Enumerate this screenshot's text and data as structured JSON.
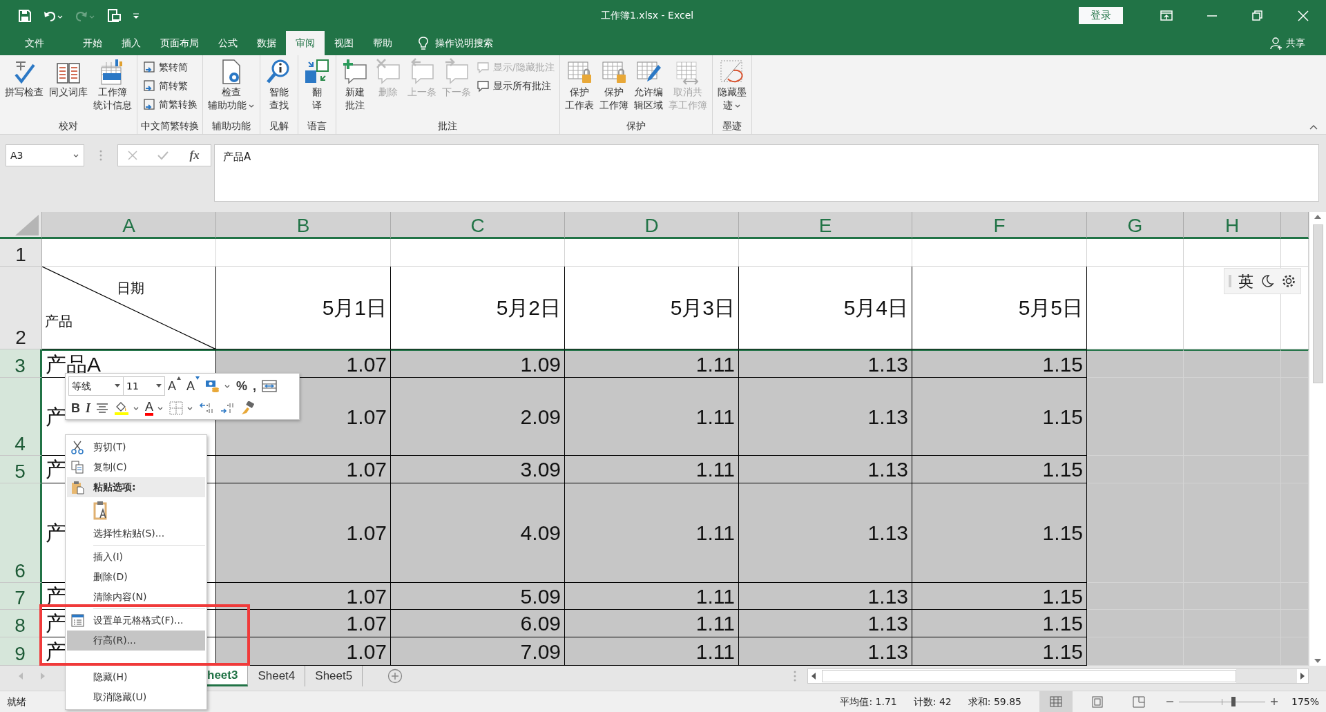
{
  "window": {
    "title": "工作簿1.xlsx  -  Excel",
    "login": "登录"
  },
  "tabs": [
    {
      "label": "文件",
      "selected": false
    },
    {
      "label": "开始",
      "selected": false
    },
    {
      "label": "插入",
      "selected": false
    },
    {
      "label": "页面布局",
      "selected": false
    },
    {
      "label": "公式",
      "selected": false
    },
    {
      "label": "数据",
      "selected": false
    },
    {
      "label": "审阅",
      "selected": true
    },
    {
      "label": "视图",
      "selected": false
    },
    {
      "label": "帮助",
      "selected": false
    }
  ],
  "tell_me": "操作说明搜索",
  "share": "共享",
  "ribbon": [
    {
      "label": "校对",
      "controls": [
        {
          "kind": "large",
          "lines": [
            "拼写检查"
          ],
          "disabled": false,
          "dropdown": false
        },
        {
          "kind": "large",
          "lines": [
            "同义词库"
          ],
          "disabled": false,
          "dropdown": false
        },
        {
          "kind": "large",
          "lines": [
            "工作簿",
            "统计信息"
          ],
          "disabled": false,
          "dropdown": false
        }
      ]
    },
    {
      "label": "中文简繁转换",
      "controls": [
        {
          "kind": "stack",
          "items": [
            {
              "label": "繁转简",
              "disabled": false
            },
            {
              "label": "简转繁",
              "disabled": false
            },
            {
              "label": "简繁转换",
              "disabled": false
            }
          ]
        }
      ]
    },
    {
      "label": "辅助功能",
      "controls": [
        {
          "kind": "large",
          "lines": [
            "检查",
            "辅助功能"
          ],
          "disabled": false,
          "dropdown": true
        }
      ]
    },
    {
      "label": "见解",
      "controls": [
        {
          "kind": "large",
          "lines": [
            "智能",
            "查找"
          ],
          "disabled": false,
          "dropdown": false
        }
      ]
    },
    {
      "label": "语言",
      "controls": [
        {
          "kind": "large",
          "lines": [
            "翻",
            "译"
          ],
          "disabled": false,
          "dropdown": false
        }
      ]
    },
    {
      "label": "批注",
      "controls": [
        {
          "kind": "large",
          "lines": [
            "新建",
            "批注"
          ],
          "disabled": false,
          "dropdown": false
        },
        {
          "kind": "large",
          "lines": [
            "删除"
          ],
          "disabled": true,
          "dropdown": false
        },
        {
          "kind": "large",
          "lines": [
            "上一条"
          ],
          "disabled": true,
          "dropdown": false
        },
        {
          "kind": "large",
          "lines": [
            "下一条"
          ],
          "disabled": true,
          "dropdown": false
        },
        {
          "kind": "stack",
          "items": [
            {
              "label": "显示/隐藏批注",
              "disabled": true
            },
            {
              "label": "显示所有批注",
              "disabled": false
            }
          ]
        }
      ]
    },
    {
      "label": "保护",
      "controls": [
        {
          "kind": "large",
          "lines": [
            "保护",
            "工作表"
          ],
          "disabled": false,
          "dropdown": false
        },
        {
          "kind": "large",
          "lines": [
            "保护",
            "工作簿"
          ],
          "disabled": false,
          "dropdown": false
        },
        {
          "kind": "large",
          "lines": [
            "允许编",
            "辑区域"
          ],
          "disabled": false,
          "dropdown": false
        },
        {
          "kind": "large",
          "lines": [
            "取消共",
            "享工作簿"
          ],
          "disabled": true,
          "dropdown": false
        }
      ]
    },
    {
      "label": "墨迹",
      "controls": [
        {
          "kind": "large",
          "lines": [
            "隐藏墨",
            "迹"
          ],
          "disabled": false,
          "dropdown": true
        }
      ]
    }
  ],
  "formula_bar": {
    "name_box": "A3",
    "function_label": "fx",
    "formula": "产品A"
  },
  "sheet": {
    "columns": [
      "A",
      "B",
      "C",
      "D",
      "E",
      "F",
      "G",
      "H"
    ],
    "rows": [
      {
        "number": "1",
        "selected": false,
        "cells": [
          "",
          "",
          "",
          "",
          "",
          "",
          "",
          ""
        ]
      },
      {
        "number": "2",
        "selected": false,
        "diagonal": {
          "top": "日期",
          "bottom": "产品"
        },
        "cells": [
          "",
          "5月1日",
          "5月2日",
          "5月3日",
          "5月4日",
          "5月5日",
          "",
          ""
        ]
      },
      {
        "number": "3",
        "selected": true,
        "cells": [
          "产品A",
          "1.07",
          "1.09",
          "1.11",
          "1.13",
          "1.15",
          "",
          ""
        ]
      },
      {
        "number": "4",
        "selected": true,
        "cells": [
          "产",
          "1.07",
          "2.09",
          "1.11",
          "1.13",
          "1.15",
          "",
          ""
        ]
      },
      {
        "number": "5",
        "selected": true,
        "cells": [
          "产",
          "1.07",
          "3.09",
          "1.11",
          "1.13",
          "1.15",
          "",
          ""
        ]
      },
      {
        "number": "6",
        "selected": true,
        "cells": [
          "产",
          "1.07",
          "4.09",
          "1.11",
          "1.13",
          "1.15",
          "",
          ""
        ]
      },
      {
        "number": "7",
        "selected": true,
        "cells": [
          "产",
          "1.07",
          "5.09",
          "1.11",
          "1.13",
          "1.15",
          "",
          ""
        ]
      },
      {
        "number": "8",
        "selected": true,
        "cells": [
          "产",
          "1.07",
          "6.09",
          "1.11",
          "1.13",
          "1.15",
          "",
          ""
        ]
      },
      {
        "number": "9",
        "selected": true,
        "cells": [
          "产",
          "1.07",
          "7.09",
          "1.11",
          "1.13",
          "1.15",
          "",
          ""
        ]
      }
    ]
  },
  "ime_bar": {
    "label": "英"
  },
  "mini_toolbar": {
    "font": "等线",
    "size": "11",
    "buttons": [
      [
        {
          "kind": "grow",
          "label": "A"
        },
        {
          "kind": "shrink",
          "label": "A"
        },
        {
          "kind": "accounting"
        },
        {
          "kind": "text",
          "label": "%"
        },
        {
          "kind": "text",
          "label": ","
        },
        {
          "kind": "wrap"
        }
      ],
      [
        {
          "kind": "bold",
          "label": "B"
        },
        {
          "kind": "italic",
          "label": "I"
        },
        {
          "kind": "align"
        },
        {
          "kind": "fill"
        },
        {
          "kind": "fontcolor",
          "label": "A"
        },
        {
          "kind": "borders"
        },
        {
          "kind": "incdec"
        },
        {
          "kind": "decdec"
        },
        {
          "kind": "painter"
        }
      ]
    ]
  },
  "context_menu": [
    {
      "kind": "item",
      "label": "剪切(T)",
      "selected": false
    },
    {
      "kind": "item",
      "label": "复制(C)",
      "selected": false
    },
    {
      "kind": "header",
      "label": "粘贴选项:",
      "selected": false
    },
    {
      "kind": "paste-option",
      "selected": false
    },
    {
      "kind": "item",
      "label": "选择性粘贴(S)...",
      "selected": false
    },
    {
      "kind": "separator"
    },
    {
      "kind": "item",
      "label": "插入(I)",
      "selected": false
    },
    {
      "kind": "item",
      "label": "删除(D)",
      "selected": false
    },
    {
      "kind": "item",
      "label": "清除内容(N)",
      "selected": false
    },
    {
      "kind": "separator"
    },
    {
      "kind": "item",
      "label": "设置单元格格式(F)...",
      "selected": false
    },
    {
      "kind": "item",
      "label": "行高(R)...",
      "selected": true
    },
    {
      "kind": "item",
      "label": "隐藏(H)",
      "selected": false
    },
    {
      "kind": "item",
      "label": "取消隐藏(U)",
      "selected": false
    }
  ],
  "sheet_tabs": [
    {
      "label": "heet3",
      "selected": true
    },
    {
      "label": "Sheet4",
      "selected": false
    },
    {
      "label": "Sheet5",
      "selected": false
    }
  ],
  "status_bar": {
    "ready": "就绪",
    "average": "平均值: 1.71",
    "count": "计数: 42",
    "sum": "求和: 59.85",
    "views": [
      {
        "selected": true
      },
      {
        "selected": false
      },
      {
        "selected": false
      }
    ],
    "zoom_slider": {
      "level": 0.63
    },
    "zoom": "175%"
  }
}
